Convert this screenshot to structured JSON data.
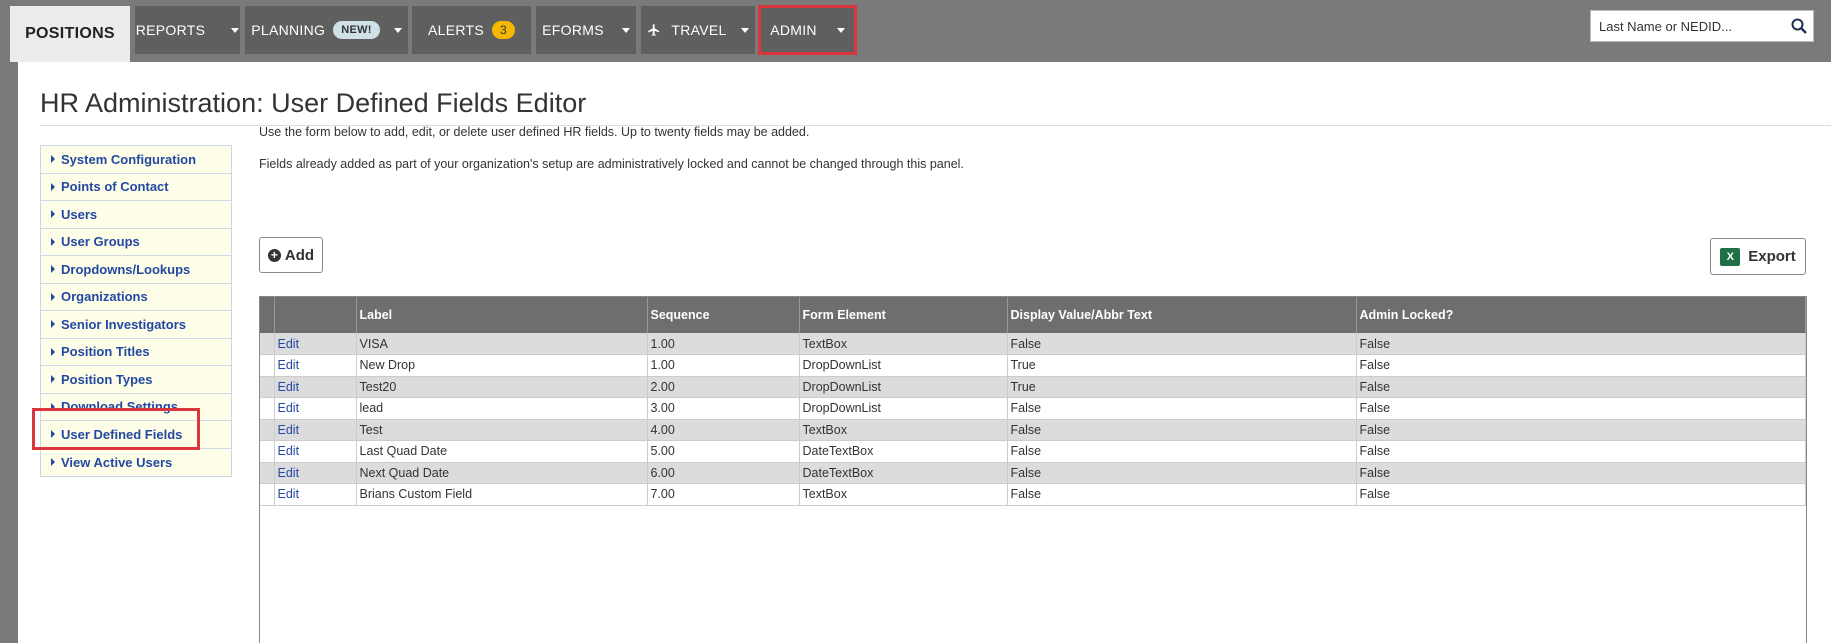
{
  "nav": {
    "tabs": [
      {
        "label": "POSITIONS"
      },
      {
        "label": "REPORTS"
      },
      {
        "label": "PLANNING",
        "badge": "NEW!"
      },
      {
        "label": "ALERTS",
        "badge": "3"
      },
      {
        "label": "EFORMS"
      },
      {
        "label": "TRAVEL",
        "icon": "airplane-icon"
      },
      {
        "label": "ADMIN"
      }
    ],
    "search_placeholder": "Last Name or NEDID..."
  },
  "page": {
    "title": "HR Administration: User Defined Fields Editor",
    "intro_1": "Use the form below to add, edit, or delete user defined HR fields. Up to twenty fields may be added.",
    "intro_2": "Fields already added as part of your organization's setup are administratively locked and cannot be changed through this panel.",
    "add_label": "Add",
    "export_label": "Export"
  },
  "sidebar": {
    "items": [
      {
        "label": "System Configuration"
      },
      {
        "label": "Points of Contact"
      },
      {
        "label": "Users"
      },
      {
        "label": "User Groups"
      },
      {
        "label": "Dropdowns/Lookups"
      },
      {
        "label": "Organizations"
      },
      {
        "label": "Senior Investigators"
      },
      {
        "label": "Position Titles"
      },
      {
        "label": "Position Types"
      },
      {
        "label": "Download Settings"
      },
      {
        "label": "User Defined Fields"
      },
      {
        "label": "View Active Users"
      }
    ]
  },
  "table": {
    "headers": [
      "",
      "",
      "Label",
      "Sequence",
      "Form Element",
      "Display Value/Abbr Text",
      "Admin Locked?"
    ],
    "edit_label": "Edit",
    "rows": [
      {
        "label": "VISA",
        "sequence": "1.00",
        "form_element": "TextBox",
        "display": "False",
        "locked": "False"
      },
      {
        "label": "New Drop",
        "sequence": "1.00",
        "form_element": "DropDownList",
        "display": "True",
        "locked": "False"
      },
      {
        "label": "Test20",
        "sequence": "2.00",
        "form_element": "DropDownList",
        "display": "True",
        "locked": "False"
      },
      {
        "label": "lead",
        "sequence": "3.00",
        "form_element": "DropDownList",
        "display": "False",
        "locked": "False"
      },
      {
        "label": "Test",
        "sequence": "4.00",
        "form_element": "TextBox",
        "display": "False",
        "locked": "False"
      },
      {
        "label": "Last Quad Date",
        "sequence": "5.00",
        "form_element": "DateTextBox",
        "display": "False",
        "locked": "False"
      },
      {
        "label": "Next Quad Date",
        "sequence": "6.00",
        "form_element": "DateTextBox",
        "display": "False",
        "locked": "False"
      },
      {
        "label": "Brians Custom Field",
        "sequence": "7.00",
        "form_element": "TextBox",
        "display": "False",
        "locked": "False"
      }
    ]
  },
  "colors": {
    "nav_bg": "#7a7a7a",
    "tab_bg": "#5f5f5f",
    "link": "#2348a3",
    "highlight": "#d9363e",
    "alert_badge": "#f5b700"
  }
}
